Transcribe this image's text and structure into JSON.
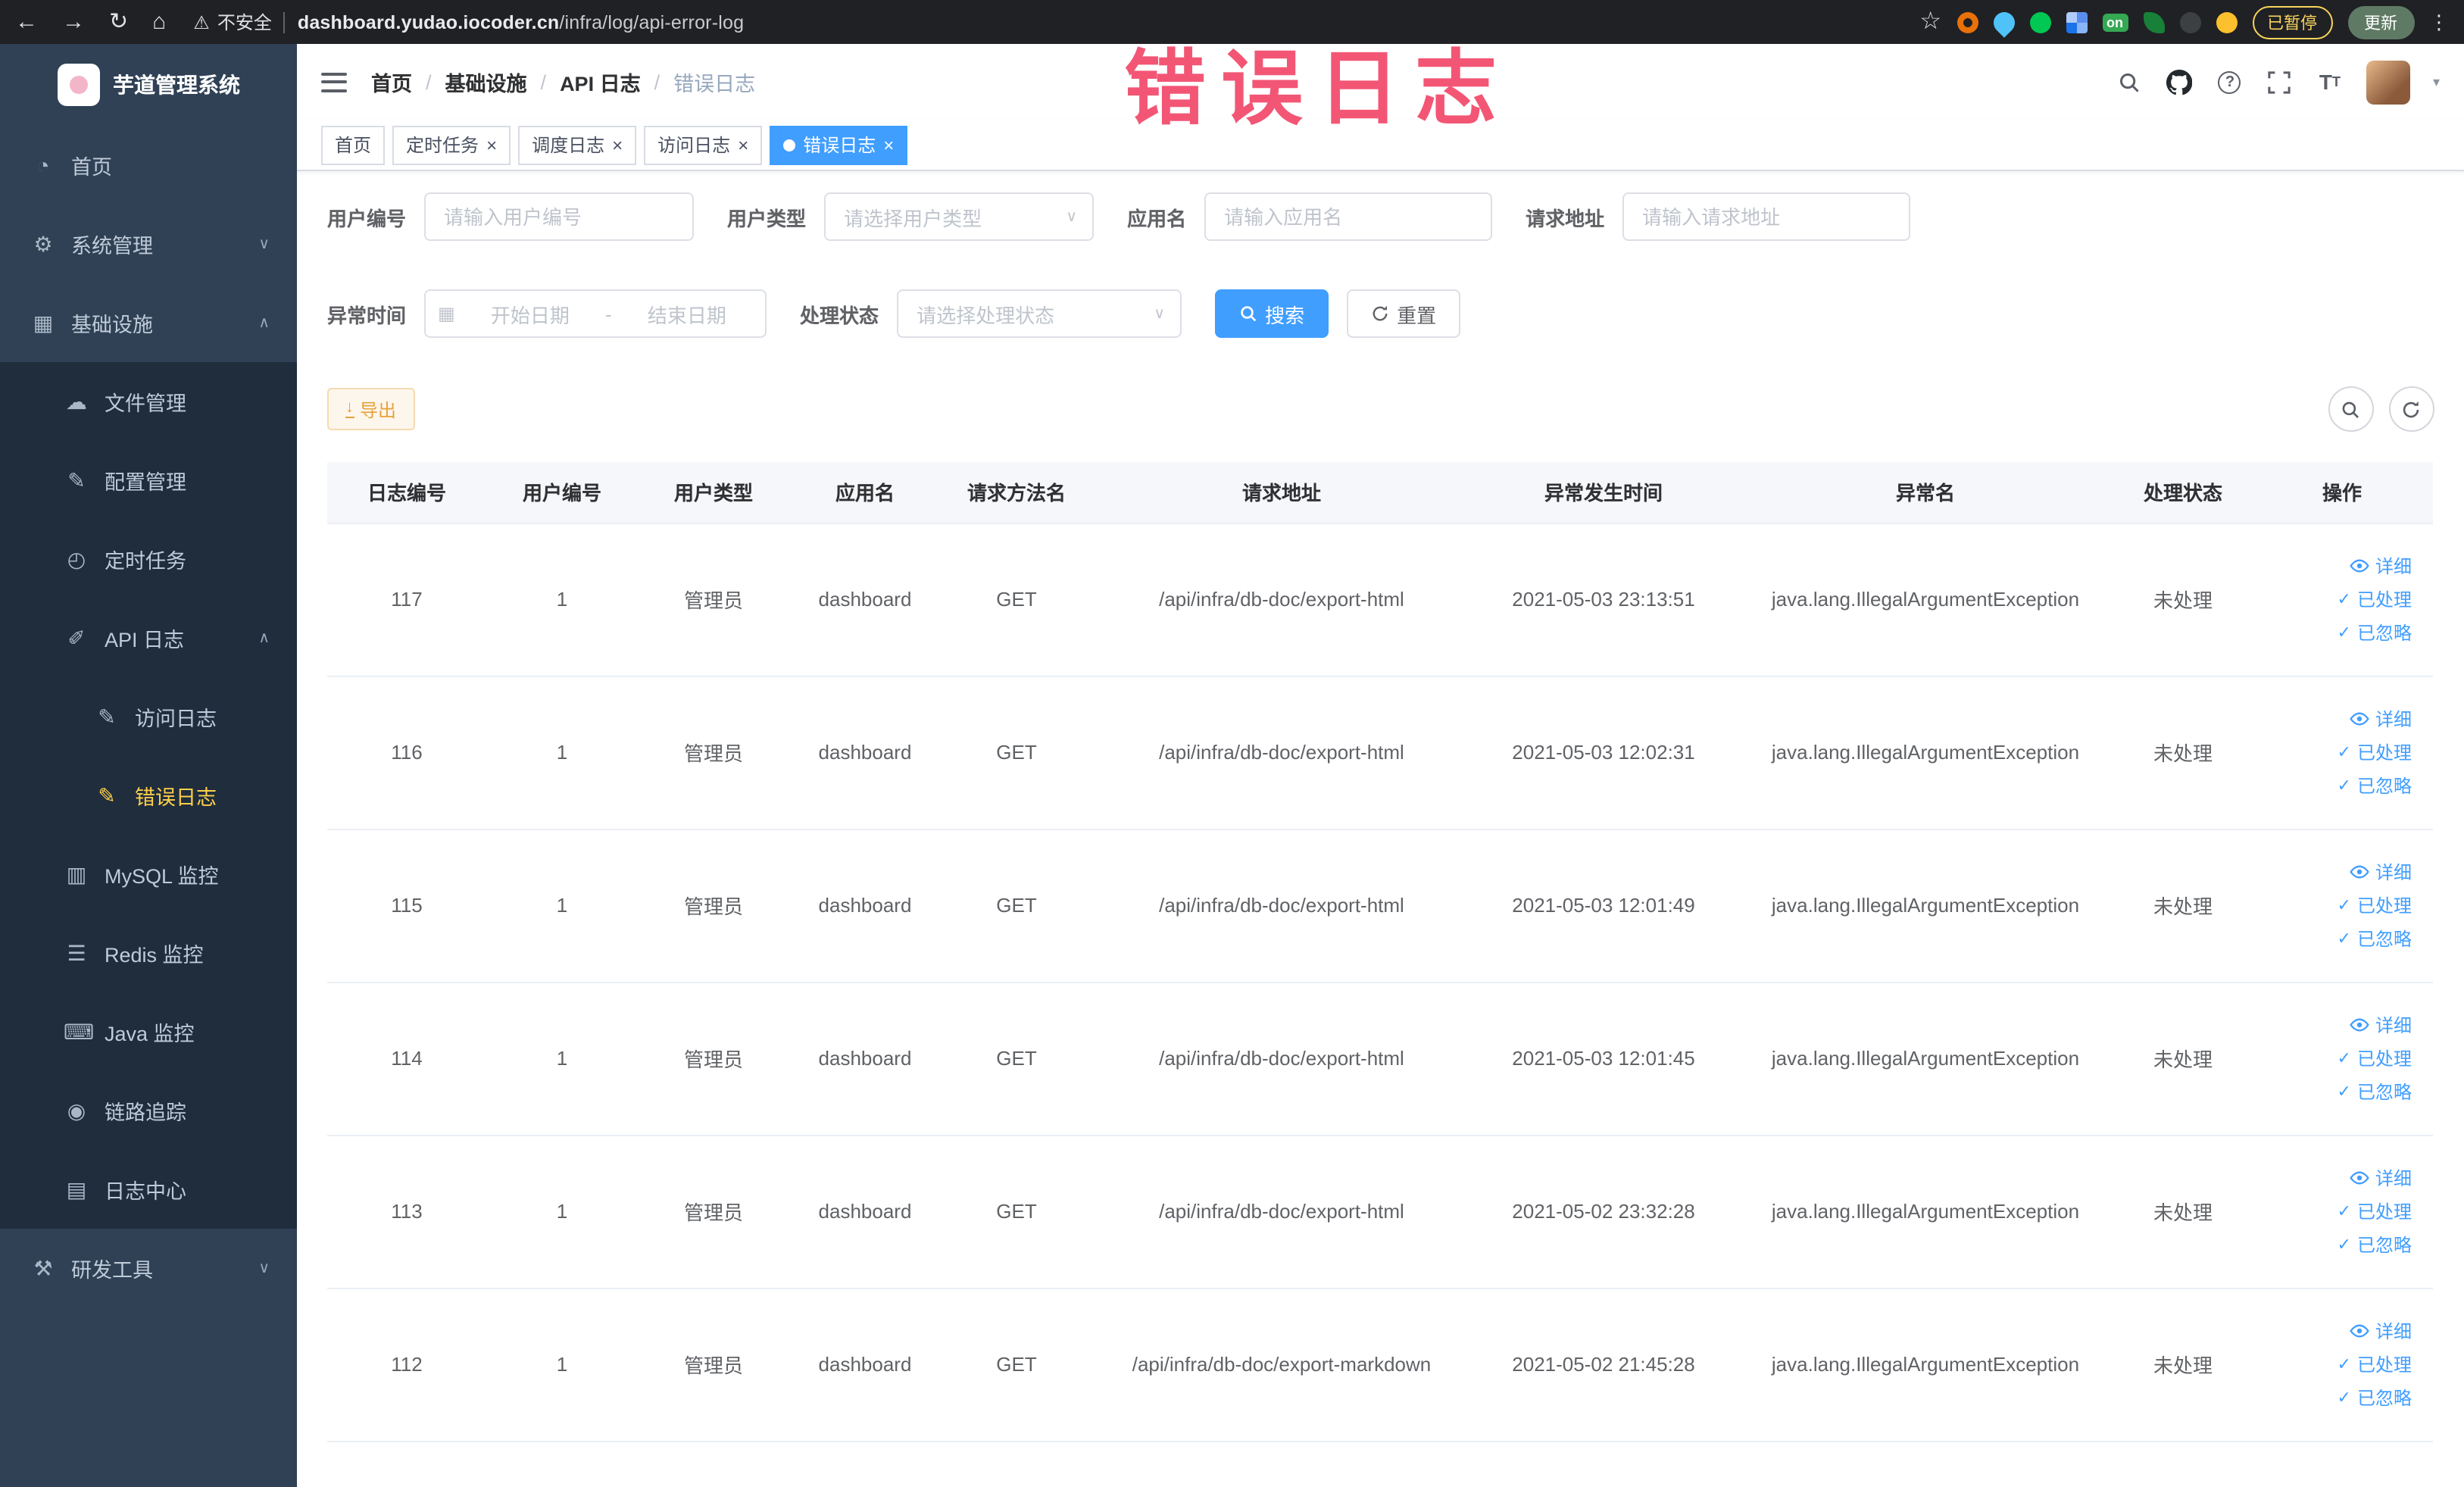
{
  "browser": {
    "security_label": "不安全",
    "url_domain": "dashboard.yudao.iocoder.cn",
    "url_path": "/infra/log/api-error-log",
    "extension_badge": "on",
    "paused_button": "已暂停",
    "update_button": "更新"
  },
  "sidebar": {
    "logo_title": "芋道管理系统",
    "items": [
      {
        "label": "首页"
      },
      {
        "label": "系统管理"
      },
      {
        "label": "基础设施"
      },
      {
        "label": "文件管理"
      },
      {
        "label": "配置管理"
      },
      {
        "label": "定时任务"
      },
      {
        "label": "API 日志"
      },
      {
        "label": "访问日志"
      },
      {
        "label": "错误日志"
      },
      {
        "label": "MySQL 监控"
      },
      {
        "label": "Redis 监控"
      },
      {
        "label": "Java 监控"
      },
      {
        "label": "链路追踪"
      },
      {
        "label": "日志中心"
      },
      {
        "label": "研发工具"
      }
    ]
  },
  "header": {
    "breadcrumbs": [
      "首页",
      "基础设施",
      "API 日志",
      "错误日志"
    ]
  },
  "annotation": {
    "watermark": "错误日志"
  },
  "tabs": [
    {
      "label": "首页"
    },
    {
      "label": "定时任务"
    },
    {
      "label": "调度日志"
    },
    {
      "label": "访问日志"
    },
    {
      "label": "错误日志"
    }
  ],
  "filters": {
    "user_id_label": "用户编号",
    "user_id_placeholder": "请输入用户编号",
    "user_type_label": "用户类型",
    "user_type_placeholder": "请选择用户类型",
    "app_name_label": "应用名",
    "app_name_placeholder": "请输入应用名",
    "request_url_label": "请求地址",
    "request_url_placeholder": "请输入请求地址",
    "exception_time_label": "异常时间",
    "date_start_placeholder": "开始日期",
    "date_separator": "-",
    "date_end_placeholder": "结束日期",
    "process_status_label": "处理状态",
    "process_status_placeholder": "请选择处理状态",
    "search_button": "搜索",
    "reset_button": "重置"
  },
  "toolbar": {
    "export_button": "导出"
  },
  "table": {
    "columns": [
      "日志编号",
      "用户编号",
      "用户类型",
      "应用名",
      "请求方法名",
      "请求地址",
      "异常发生时间",
      "异常名",
      "处理状态",
      "操作"
    ],
    "row_actions": [
      "详细",
      "已处理",
      "已忽略"
    ],
    "rows": [
      {
        "id": "117",
        "user_id": "1",
        "user_type": "管理员",
        "app": "dashboard",
        "method": "GET",
        "url": "/api/infra/db-doc/export-html",
        "time": "2021-05-03 23:13:51",
        "exception": "java.lang.IllegalArgumentException",
        "status": "未处理"
      },
      {
        "id": "116",
        "user_id": "1",
        "user_type": "管理员",
        "app": "dashboard",
        "method": "GET",
        "url": "/api/infra/db-doc/export-html",
        "time": "2021-05-03 12:02:31",
        "exception": "java.lang.IllegalArgumentException",
        "status": "未处理"
      },
      {
        "id": "115",
        "user_id": "1",
        "user_type": "管理员",
        "app": "dashboard",
        "method": "GET",
        "url": "/api/infra/db-doc/export-html",
        "time": "2021-05-03 12:01:49",
        "exception": "java.lang.IllegalArgumentException",
        "status": "未处理"
      },
      {
        "id": "114",
        "user_id": "1",
        "user_type": "管理员",
        "app": "dashboard",
        "method": "GET",
        "url": "/api/infra/db-doc/export-html",
        "time": "2021-05-03 12:01:45",
        "exception": "java.lang.IllegalArgumentException",
        "status": "未处理"
      },
      {
        "id": "113",
        "user_id": "1",
        "user_type": "管理员",
        "app": "dashboard",
        "method": "GET",
        "url": "/api/infra/db-doc/export-html",
        "time": "2021-05-02 23:32:28",
        "exception": "java.lang.IllegalArgumentException",
        "status": "未处理"
      },
      {
        "id": "112",
        "user_id": "1",
        "user_type": "管理员",
        "app": "dashboard",
        "method": "GET",
        "url": "/api/infra/db-doc/export-markdown",
        "time": "2021-05-02 21:45:28",
        "exception": "java.lang.IllegalArgumentException",
        "status": "未处理"
      }
    ]
  },
  "colors": {
    "accent_blue": "#409eff",
    "sidebar_bg": "#304156",
    "submenu_bg": "#1f2d3d",
    "active_menu_text": "#ffd04b",
    "warning_button_text": "#e6a23c",
    "watermark_red": "#f24869"
  },
  "icons": {
    "back": "←",
    "forward": "→",
    "reload": "↻",
    "home": "⌂",
    "warning": "⚠",
    "star": "☆",
    "more": "⋮",
    "dashboard": "◔",
    "gear": "⚙",
    "infra": "▦",
    "file": "☁",
    "config": "✎",
    "job": "◴",
    "api-log": "✐",
    "access-log": "✎",
    "error-log": "✎",
    "mysql": "▥",
    "redis": "☰",
    "java": "⌨",
    "trace": "◉",
    "log-center": "▤",
    "tools": "⚒",
    "chevron-down": "∨",
    "chevron-up": "∧",
    "close": "×",
    "select-arrow": "∨",
    "calendar": "▦",
    "download": "↓",
    "check": "✓",
    "caret-down": "▾"
  }
}
